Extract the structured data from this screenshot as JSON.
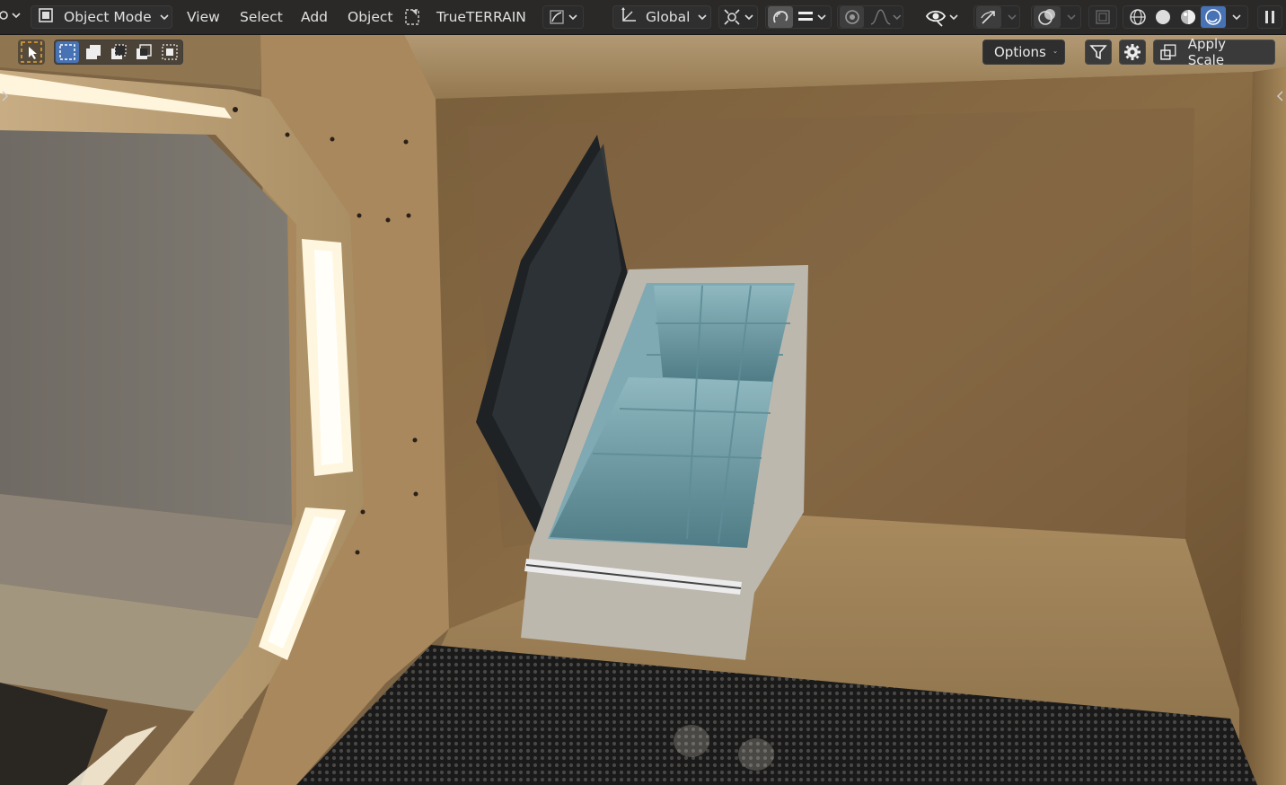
{
  "header": {
    "mode_label": "Object Mode",
    "menus": {
      "view": "View",
      "select": "Select",
      "add": "Add",
      "object": "Object"
    },
    "addon_label": "TrueTERRAIN",
    "orientation_label": "Global"
  },
  "tool_header": {
    "options_label": "Options",
    "apply_scale_label": "Apply Scale"
  },
  "icons": {
    "editor_type": "editor-type-icon",
    "object_mode": "object-mode-icon",
    "transform_orientation": "transform-orientation-icon",
    "pivot": "pivot-point-icon",
    "snap": "snap-magnet-icon",
    "proportional": "proportional-edit-icon",
    "visibility": "eye-icon",
    "gizmo": "gizmo-icon",
    "overlay": "overlay-icon",
    "xray": "xray-icon",
    "shading_wire": "wireframe-shading-icon",
    "shading_solid": "solid-shading-icon",
    "shading_material": "material-shading-icon",
    "shading_rendered": "rendered-shading-icon",
    "filter": "filter-icon",
    "settings": "gear-icon",
    "select_tool": "select-cursor-icon"
  },
  "colors": {
    "header_bg": "#262626",
    "active_blue": "#4772b3",
    "tool_highlight": "#e0a13a"
  }
}
